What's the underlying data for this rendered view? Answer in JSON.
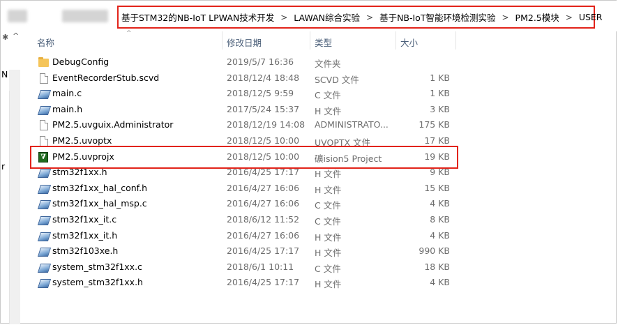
{
  "breadcrumb": [
    "基于STM32的NB-IoT LPWAN技术开发",
    "LAWAN综合实验",
    "基于NB-IoT智能环境检测实验",
    "PM2.5模块",
    "USER"
  ],
  "nav_partial_text": [
    "N",
    "r"
  ],
  "columns": {
    "name": "名称",
    "date": "修改日期",
    "type": "类型",
    "size": "大小"
  },
  "files": [
    {
      "name": "DebugConfig",
      "date": "2019/5/7 16:36",
      "type": "文件夹",
      "size": "",
      "icon": "folder-icon"
    },
    {
      "name": "EventRecorderStub.scvd",
      "date": "2018/12/4 18:48",
      "type": "SCVD 文件",
      "size": "1 KB",
      "icon": "file-icon"
    },
    {
      "name": "main.c",
      "date": "2018/12/5 9:59",
      "type": "C 文件",
      "size": "1 KB",
      "icon": "source-file-icon"
    },
    {
      "name": "main.h",
      "date": "2017/5/24 15:37",
      "type": "H 文件",
      "size": "3 KB",
      "icon": "source-file-icon"
    },
    {
      "name": "PM2.5.uvguix.Administrator",
      "date": "2018/12/19 14:08",
      "type": "ADMINISTRATO...",
      "size": "175 KB",
      "icon": "file-icon"
    },
    {
      "name": "PM2.5.uvoptx",
      "date": "2018/12/5 10:00",
      "type": "UVOPTX 文件",
      "size": "17 KB",
      "icon": "file-icon"
    },
    {
      "name": "PM2.5.uvprojx",
      "date": "2018/12/5 10:00",
      "type": "礦ision5 Project",
      "size": "19 KB",
      "icon": "uvision-project-icon"
    },
    {
      "name": "stm32f1xx.h",
      "date": "2016/4/25 17:17",
      "type": "H 文件",
      "size": "9 KB",
      "icon": "source-file-icon"
    },
    {
      "name": "stm32f1xx_hal_conf.h",
      "date": "2016/4/27 16:06",
      "type": "H 文件",
      "size": "15 KB",
      "icon": "source-file-icon"
    },
    {
      "name": "stm32f1xx_hal_msp.c",
      "date": "2016/4/27 16:06",
      "type": "C 文件",
      "size": "4 KB",
      "icon": "source-file-icon"
    },
    {
      "name": "stm32f1xx_it.c",
      "date": "2018/6/12 11:52",
      "type": "C 文件",
      "size": "8 KB",
      "icon": "source-file-icon"
    },
    {
      "name": "stm32f1xx_it.h",
      "date": "2016/4/27 16:06",
      "type": "H 文件",
      "size": "4 KB",
      "icon": "source-file-icon"
    },
    {
      "name": "stm32f103xe.h",
      "date": "2016/4/25 17:17",
      "type": "H 文件",
      "size": "990 KB",
      "icon": "source-file-icon"
    },
    {
      "name": "system_stm32f1xx.c",
      "date": "2018/6/1 10:11",
      "type": "C 文件",
      "size": "18 KB",
      "icon": "source-file-icon"
    },
    {
      "name": "system_stm32f1xx.h",
      "date": "2016/4/25 17:17",
      "type": "H 文件",
      "size": "4 KB",
      "icon": "source-file-icon"
    }
  ],
  "colors": {
    "annotation_red": "#e2231a",
    "header_text": "#4c607a",
    "detail_text": "#6d6d6d"
  }
}
